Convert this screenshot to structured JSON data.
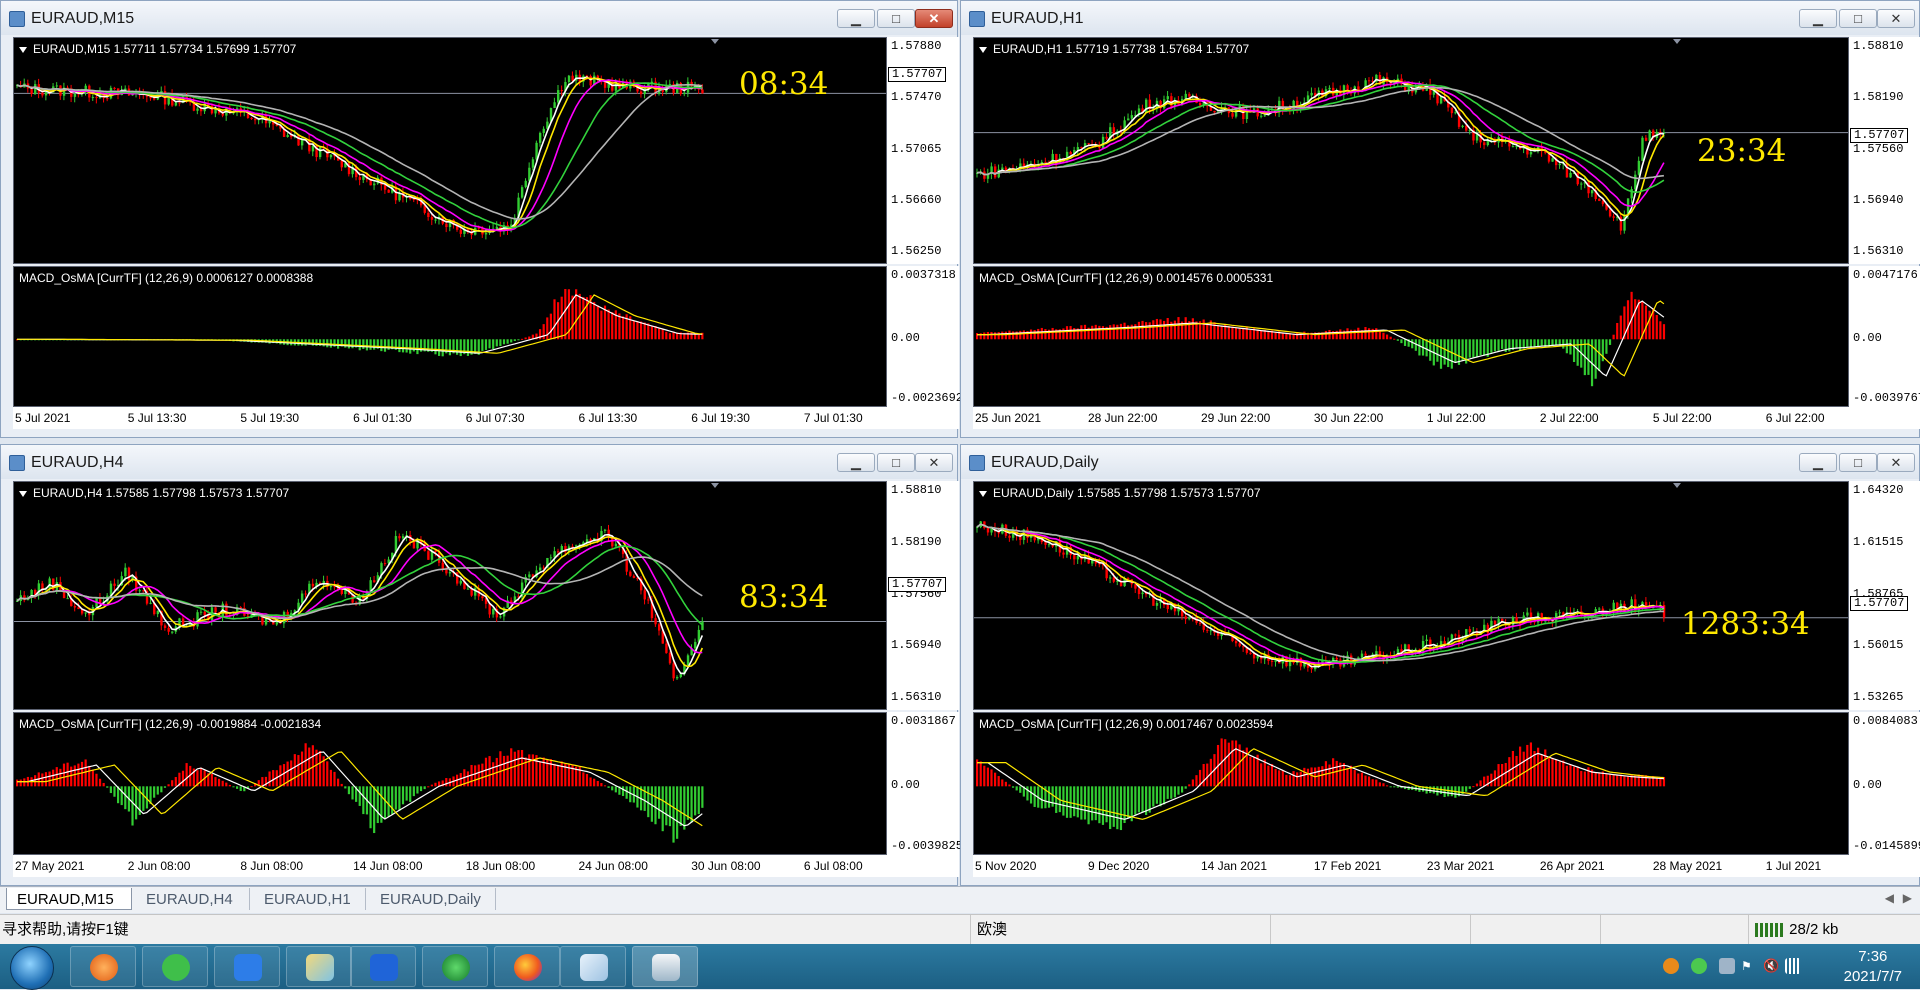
{
  "windows": [
    {
      "id": "m15",
      "title": "EURAUD,M15",
      "close_active": true,
      "price_info": "EURAUD,M15  1.57711 1.57734 1.57699 1.57707",
      "price_ticks": [
        "1.57880",
        "1.57470",
        "1.57065",
        "1.56660",
        "1.56250"
      ],
      "current_price": "1.57707",
      "timer": "08:34",
      "osc_info": "MACD_OsMA [CurrTF] (12,26,9) 0.0006127 0.0008388",
      "osc_ticks": [
        "0.0037318",
        "0.00",
        "-0.0023692"
      ],
      "x_ticks": [
        "5 Jul 2021",
        "5 Jul 13:30",
        "5 Jul 19:30",
        "6 Jul 01:30",
        "6 Jul 07:30",
        "6 Jul 13:30",
        "6 Jul 19:30",
        "7 Jul 01:30"
      ]
    },
    {
      "id": "h1",
      "title": "EURAUD,H1",
      "close_active": false,
      "price_info": "EURAUD,H1  1.57719 1.57738 1.57684 1.57707",
      "price_ticks": [
        "1.58810",
        "1.58190",
        "1.57560",
        "1.56940",
        "1.56310"
      ],
      "current_price": "1.57707",
      "timer": "23:34",
      "osc_info": "MACD_OsMA [CurrTF] (12,26,9) 0.0014576 0.0005331",
      "osc_ticks": [
        "0.0047176",
        "0.00",
        "-0.0039767"
      ],
      "x_ticks": [
        "25 Jun 2021",
        "28 Jun 22:00",
        "29 Jun 22:00",
        "30 Jun 22:00",
        "1 Jul 22:00",
        "2 Jul 22:00",
        "5 Jul 22:00",
        "6 Jul 22:00"
      ]
    },
    {
      "id": "h4",
      "title": "EURAUD,H4",
      "close_active": false,
      "price_info": "EURAUD,H4  1.57585 1.57798 1.57573 1.57707",
      "price_ticks": [
        "1.58810",
        "1.58190",
        "1.57560",
        "1.56940",
        "1.56310"
      ],
      "current_price": "1.57707",
      "timer": "83:34",
      "osc_info": "MACD_OsMA [CurrTF] (12,26,9) -0.0019884 -0.0021834",
      "osc_ticks": [
        "0.0031867",
        "0.00",
        "-0.0039825"
      ],
      "x_ticks": [
        "27 May 2021",
        "2 Jun 08:00",
        "8 Jun 08:00",
        "14 Jun 08:00",
        "18 Jun 08:00",
        "24 Jun 08:00",
        "30 Jun 08:00",
        "6 Jul 08:00"
      ]
    },
    {
      "id": "daily",
      "title": "EURAUD,Daily",
      "close_active": false,
      "price_info": "EURAUD,Daily  1.57585 1.57798 1.57573 1.57707",
      "price_ticks": [
        "1.64320",
        "1.61515",
        "1.58765",
        "1.56015",
        "1.53265"
      ],
      "current_price": "1.57707",
      "timer": "1283:34",
      "osc_info": "MACD_OsMA [CurrTF] (12,26,9) 0.0017467 0.0023594",
      "osc_ticks": [
        "0.0084083",
        "0.00",
        "-0.0145899"
      ],
      "x_ticks": [
        "5 Nov 2020",
        "9 Dec 2020",
        "14 Jan 2021",
        "17 Feb 2021",
        "23 Mar 2021",
        "26 Apr 2021",
        "28 May 2021",
        "1 Jul 2021"
      ]
    }
  ],
  "tabs": [
    "EURAUD,M15",
    "EURAUD,H4",
    "EURAUD,H1",
    "EURAUD,Daily"
  ],
  "active_tab": 0,
  "status": {
    "help": "寻求帮助,请按F1键",
    "profile": "欧澳",
    "traffic": "28/2 kb"
  },
  "clock": {
    "time": "7:36",
    "date": "2021/7/7"
  },
  "colors": {
    "bull": "#32cd32",
    "bear": "#ff0000",
    "ma_white": "#ffffff",
    "ma_yellow": "#ffe800",
    "ma_magenta": "#ff00ff",
    "ma_green": "#32d23c",
    "ma_silver": "#b4b4b4",
    "timer": "#ffe800"
  },
  "taskbar_apps": [
    "start-orb",
    "swirl-app",
    "wechat-app",
    "feather-app",
    "map-app",
    "lark-app",
    "circle-app",
    "firefox-app",
    "notepad-app",
    "mt4-app"
  ]
}
